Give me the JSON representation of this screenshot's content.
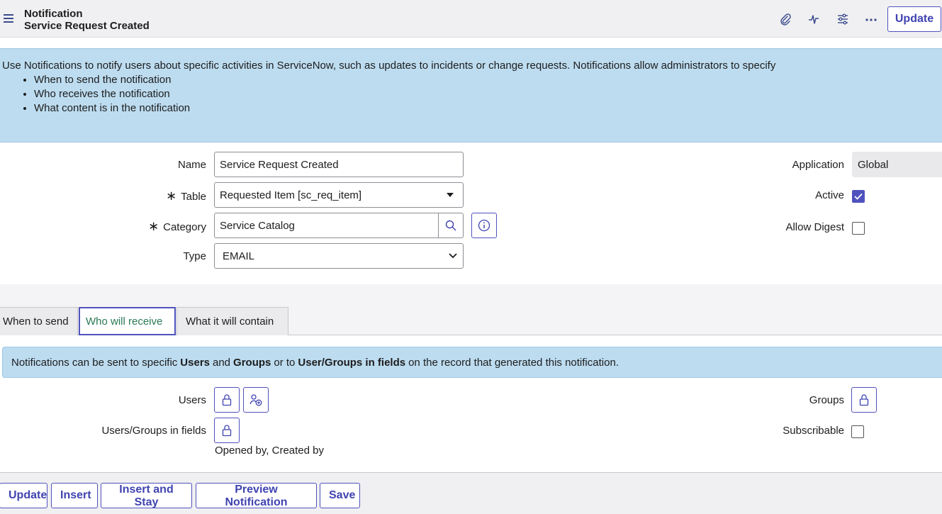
{
  "header": {
    "title_line1": "Notification",
    "title_line2": "Service Request Created",
    "update_label": "Update"
  },
  "info": {
    "intro": "Use Notifications to notify users about specific activities in ServiceNow, such as updates to incidents or change requests. Notifications allow administrators to specify",
    "bullets": [
      "When to send the notification",
      "Who receives the notification",
      "What content is in the notification"
    ]
  },
  "form": {
    "name_label": "Name",
    "name_value": "Service Request Created",
    "table_label": "Table",
    "table_value": "Requested Item [sc_req_item]",
    "category_label": "Category",
    "category_value": "Service Catalog",
    "type_label": "Type",
    "type_value": "EMAIL",
    "application_label": "Application",
    "application_value": "Global",
    "active_label": "Active",
    "active_checked": true,
    "allow_digest_label": "Allow Digest",
    "allow_digest_checked": false,
    "required_mark": "∗"
  },
  "tabs": [
    "When to send",
    "Who will receive",
    "What it will contain"
  ],
  "receive": {
    "info_part1": "Notifications can be sent to specific",
    "info_users": "Users",
    "info_and": "and",
    "info_groups": "Groups",
    "info_or": "or to",
    "info_fields": "User/Groups in fields",
    "info_part2": "on the record that generated this notification.",
    "users_label": "Users",
    "users_groups_label": "Users/Groups in fields",
    "users_groups_value": "Opened by, Created by",
    "groups_label": "Groups",
    "subscribable_label": "Subscribable",
    "subscribable_checked": false
  },
  "footer": {
    "buttons": [
      "Update",
      "Insert",
      "Insert and Stay",
      "Preview Notification",
      "Save"
    ]
  },
  "colors": {
    "accent": "#4f52bd",
    "info_bg": "#bddcf0",
    "active_tab_text": "#2a7a55"
  }
}
